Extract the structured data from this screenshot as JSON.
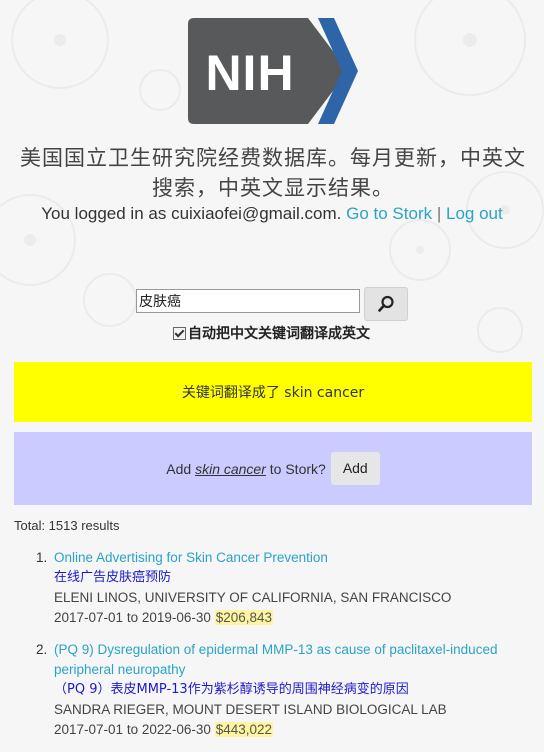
{
  "logo": {
    "text": "NIH"
  },
  "intro": "美国国立卫生研究院经费数据库。每月更新，中英文搜索，中英文显示结果。",
  "login": {
    "prefix": "You logged in as cuixiaofei@gmail.com.",
    "stork_link": "Go to Stork",
    "separator": "|",
    "logout_link": "Log out"
  },
  "search": {
    "value": "皮肤癌",
    "button_icon": "search-icon",
    "translate_label": "自动把中文关键词翻译成英文",
    "translate_checked": true
  },
  "translated_banner": "关键词翻译成了 skin cancer",
  "stork_prompt": {
    "prefix": "Add",
    "keyword": "skin cancer",
    "suffix": "to Stork?",
    "button": "Add"
  },
  "total": "Total: 1513 results",
  "results": [
    {
      "num": "1.",
      "title": "Online Advertising for Skin Cancer Prevention",
      "title_zh": "在线广告皮肤癌预防",
      "pi": "ELENI LINOS, UNIVERSITY OF CALIFORNIA, SAN FRANCISCO",
      "start": "2017-07-01",
      "to": "to",
      "end": "2019-06-30",
      "amount": "$206,843"
    },
    {
      "num": "2.",
      "title": "(PQ 9) Dysregulation of epidermal MMP-13 as cause of paclitaxel-induced peripheral neuropathy",
      "title_zh": "（PQ 9）表皮MMP-13作为紫杉醇诱导的周围神经病变的原因",
      "pi": "SANDRA RIEGER, MOUNT DESERT ISLAND BIOLOGICAL LAB",
      "start": "2017-07-01",
      "to": "to",
      "end": "2022-06-30",
      "amount": "$443,022"
    }
  ],
  "colors": {
    "link": "#2aa3c9",
    "translated_banner_bg": "#ffff00",
    "stork_banner_bg": "#cbcbff",
    "amount_highlight": "#fff5a0",
    "logo_gray": "#58595b",
    "logo_blue": "#2e64a8"
  }
}
